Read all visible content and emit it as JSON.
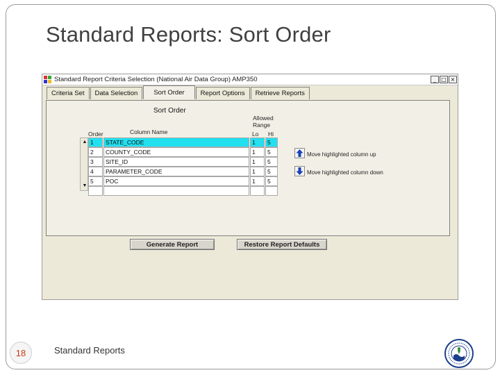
{
  "slide": {
    "title": "Standard Reports: Sort Order",
    "page_number": "18",
    "footer": "Standard Reports"
  },
  "window": {
    "title": "Standard Report Criteria Selection (National Air Data Group) AMP350",
    "controls": {
      "minimize": "_",
      "maximize": "□",
      "close": "×"
    }
  },
  "tabs": [
    {
      "label": "Criteria Set",
      "active": false
    },
    {
      "label": "Data Selection",
      "active": false
    },
    {
      "label": "Sort Order",
      "active": true
    },
    {
      "label": "Report Options",
      "active": false
    },
    {
      "label": "Retrieve Reports",
      "active": false
    }
  ],
  "sort_order": {
    "heading": "Sort Order",
    "allowed_range": "Allowed Range",
    "headers": {
      "order": "Order",
      "column_name": "Column Name",
      "lo": "Lo",
      "hi": "Hi"
    },
    "rows": [
      {
        "order": "1",
        "name": "STATE_CODE",
        "lo": "1",
        "hi": "5",
        "selected": true
      },
      {
        "order": "2",
        "name": "COUNTY_CODE",
        "lo": "1",
        "hi": "5",
        "selected": false
      },
      {
        "order": "3",
        "name": "SITE_ID",
        "lo": "1",
        "hi": "5",
        "selected": false
      },
      {
        "order": "4",
        "name": "PARAMETER_CODE",
        "lo": "1",
        "hi": "5",
        "selected": false
      },
      {
        "order": "5",
        "name": "POC",
        "lo": "1",
        "hi": "5",
        "selected": false
      },
      {
        "order": "",
        "name": "",
        "lo": "",
        "hi": "",
        "selected": false
      }
    ],
    "move_up_label": "Move highlighted column up",
    "move_down_label": "Move highlighted column down",
    "scroll_up": "▲",
    "scroll_down": "▼"
  },
  "buttons": {
    "generate": "Generate Report",
    "restore": "Restore Report Defaults"
  },
  "colors": {
    "selected_row": "#22e0ef",
    "window_bg": "#ece9d8",
    "arrow_blue": "#1a3fb5",
    "page_number": "#c83a1a"
  }
}
